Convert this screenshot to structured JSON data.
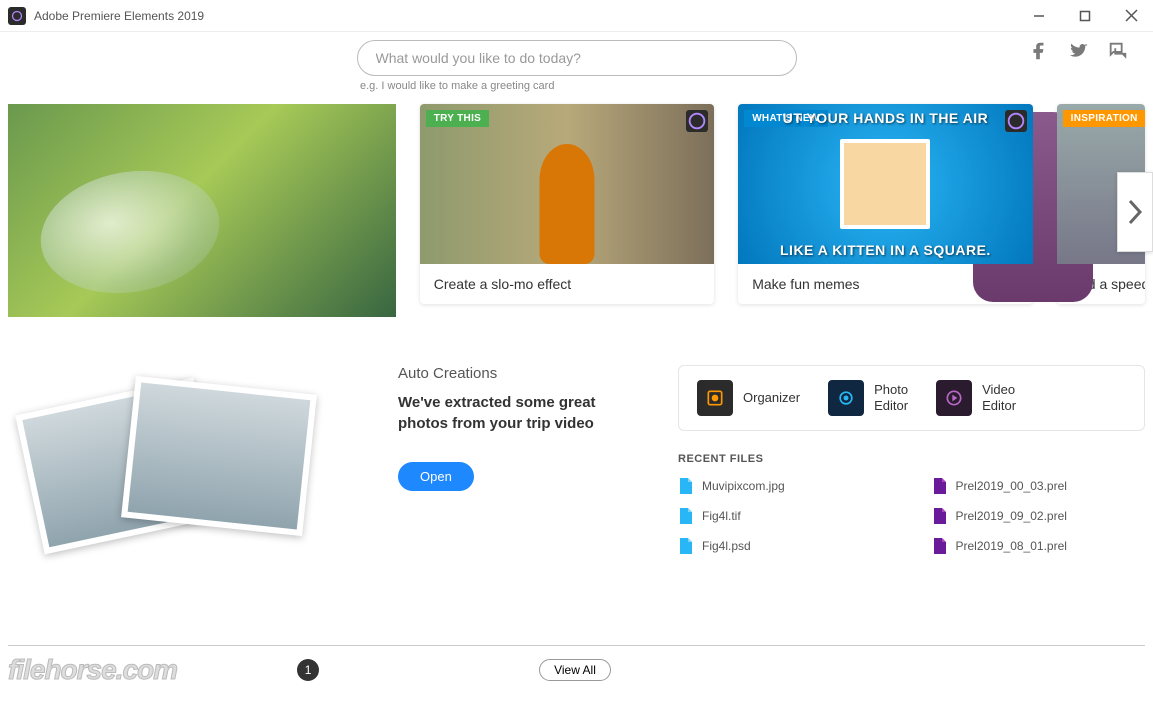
{
  "titlebar": {
    "app_name": "Adobe Premiere Elements 2019"
  },
  "search": {
    "placeholder": "What would you like to do today?",
    "hint": "e.g. I would like to make a greeting card"
  },
  "carousel": {
    "cards": [
      {
        "caption": ""
      },
      {
        "badge": "TRY THIS",
        "caption": "Create a slo-mo effect"
      },
      {
        "badge": "WHAT'S NEW",
        "caption": "Make fun memes",
        "meme_top": "UT YOUR HANDS IN THE AIR",
        "meme_bottom": "LIKE A KITTEN IN A SQUARE."
      },
      {
        "badge": "INSPIRATION",
        "caption": "Add a speed"
      }
    ]
  },
  "auto": {
    "heading": "Auto Creations",
    "desc": "We've extracted some great photos from your trip video",
    "open_label": "Open"
  },
  "editors": [
    {
      "label": "Organizer"
    },
    {
      "label": "Photo\nEditor"
    },
    {
      "label": "Video\nEditor"
    }
  ],
  "recent": {
    "heading": "RECENT FILES",
    "files": [
      {
        "name": "Muvipixcom.jpg",
        "type": "img"
      },
      {
        "name": "Prel2019_00_03.prel",
        "type": "prel"
      },
      {
        "name": "Fig4l.tif",
        "type": "img"
      },
      {
        "name": "Prel2019_09_02.prel",
        "type": "prel"
      },
      {
        "name": "Fig4l.psd",
        "type": "img"
      },
      {
        "name": "Prel2019_08_01.prel",
        "type": "prel"
      }
    ]
  },
  "footer": {
    "watermark": "filehorse.com",
    "page": "1",
    "viewall": "View All"
  }
}
